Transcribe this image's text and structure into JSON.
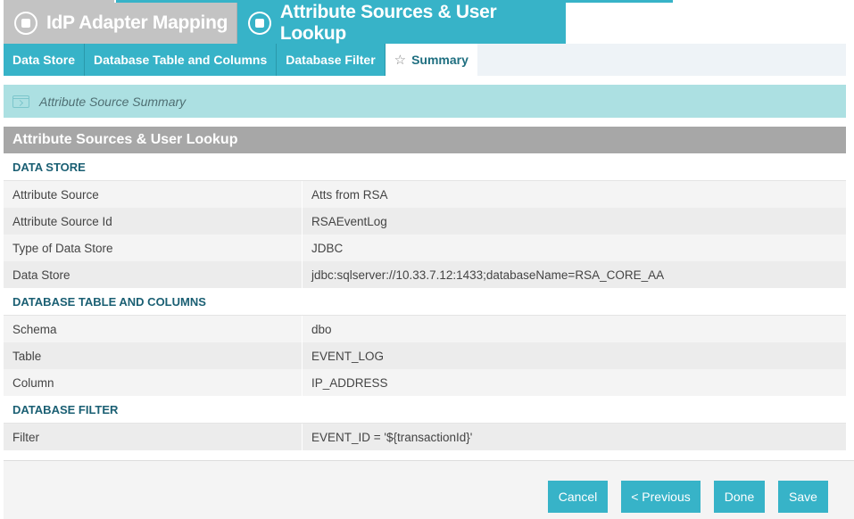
{
  "colors": {
    "accent": "#37b3c8",
    "inactive_tab": "#c3c3c3",
    "info_bar": "#ace0e2",
    "panel_header": "#a7a7a7",
    "section_heading": "#1a5f73"
  },
  "main_tabs": [
    {
      "label": "IdP Adapter Mapping",
      "icon": "step-circle-icon"
    },
    {
      "label": "Attribute Sources & User Lookup",
      "icon": "step-circle-icon"
    }
  ],
  "sub_tabs": [
    {
      "label": "Data Store"
    },
    {
      "label": "Database Table and Columns"
    },
    {
      "label": "Database Filter"
    },
    {
      "label": "Summary",
      "icon": "star-icon"
    }
  ],
  "info_bar": {
    "text": "Attribute Source Summary",
    "icon": "summary-icon"
  },
  "panel": {
    "title": "Attribute Sources & User Lookup",
    "sections": [
      {
        "heading": "DATA STORE",
        "rows": [
          {
            "key": "Attribute Source",
            "value": "Atts from RSA"
          },
          {
            "key": "Attribute Source Id",
            "value": "RSAEventLog"
          },
          {
            "key": "Type of Data Store",
            "value": "JDBC"
          },
          {
            "key": "Data Store",
            "value": "jdbc:sqlserver://10.33.7.12:1433;databaseName=RSA_CORE_AA"
          }
        ]
      },
      {
        "heading": "DATABASE TABLE AND COLUMNS",
        "rows": [
          {
            "key": "Schema",
            "value": "dbo"
          },
          {
            "key": "Table",
            "value": "EVENT_LOG"
          },
          {
            "key": "Column",
            "value": "IP_ADDRESS"
          }
        ]
      },
      {
        "heading": "DATABASE FILTER",
        "rows": [
          {
            "key": "Filter",
            "value": "EVENT_ID = '${transactionId}'"
          }
        ]
      }
    ]
  },
  "footer": {
    "cancel": "Cancel",
    "previous": "< Previous",
    "done": "Done",
    "save": "Save"
  }
}
